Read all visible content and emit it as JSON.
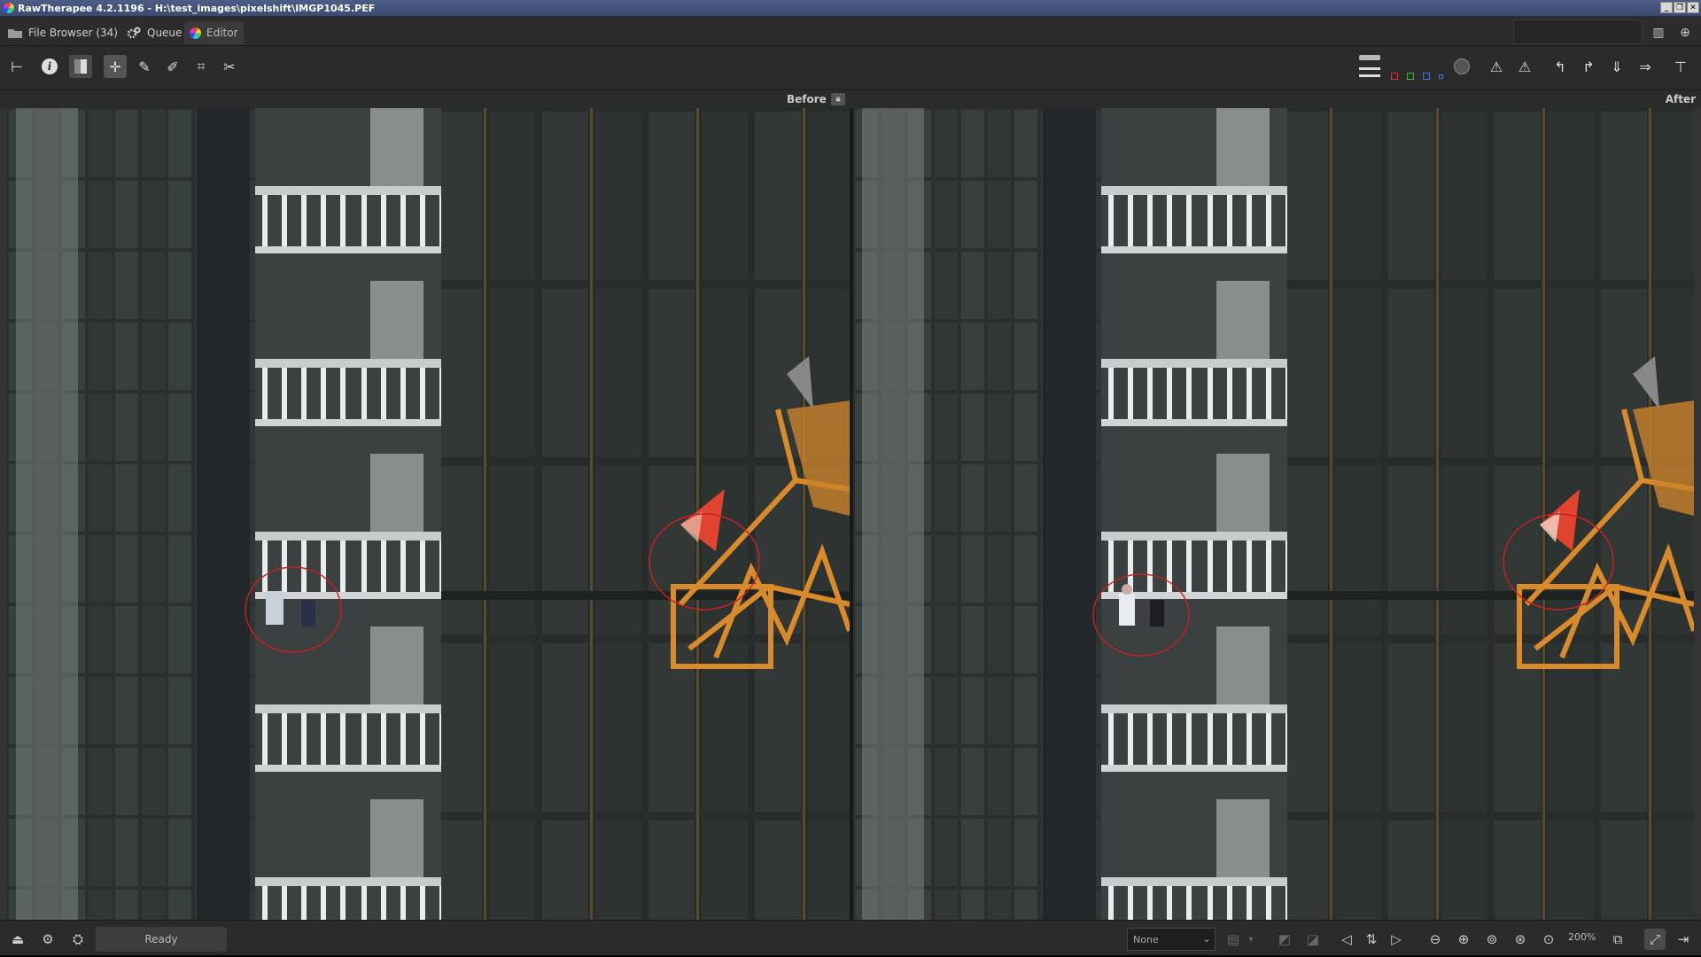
{
  "window": {
    "title": "RawTherapee 4.2.1196 - H:\\test_images\\pixelshift\\IMGP1045.PEF",
    "buttons": [
      "_",
      "❐",
      "✕"
    ]
  },
  "tabs": [
    {
      "label": "File Browser (34)",
      "icon": "folder-icon"
    },
    {
      "label": "Queue",
      "icon": "gears-icon"
    },
    {
      "label": "Editor",
      "icon": "color-wheel-icon"
    }
  ],
  "labels": {
    "before": "Before",
    "after": "After"
  },
  "status": {
    "text": "Ready"
  },
  "bottom": {
    "profile_select": "None",
    "zoom": "200%"
  },
  "colors": {
    "accent_red_circle": "#cc2020",
    "crane_orange": "#d98a2a",
    "flag": "#e0442e"
  }
}
